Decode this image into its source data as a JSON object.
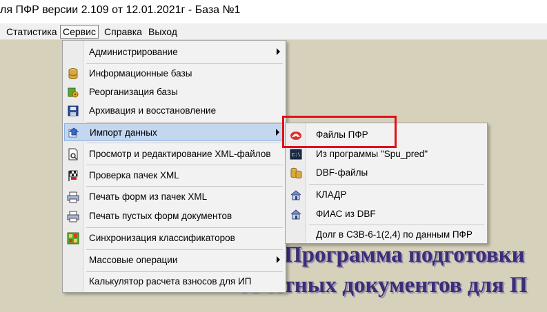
{
  "window": {
    "title": "ля ПФР версии 2.109 от 12.01.2021г - База №1"
  },
  "menubar": {
    "statistics": "Статистика",
    "service": "Сервис",
    "help": "Справка",
    "exit": "Выход"
  },
  "service_menu": {
    "administration": "Администрирование",
    "info_bases": "Информационные базы",
    "reorg_base": "Реорганизация базы",
    "archive_restore": "Архивация и восстановление",
    "import_data": "Импорт данных",
    "xml_edit": "Просмотр и редактирование XML-файлов",
    "xml_check": "Проверка пачек XML",
    "print_xml": "Печать форм из пачек XML",
    "print_blank": "Печать пустых форм документов",
    "sync_classifiers": "Синхронизация классификаторов",
    "mass_operations": "Массовые операции",
    "calculator": "Калькулятор расчета взносов для ИП"
  },
  "import_submenu": {
    "pfr_files": "Файлы ПФР",
    "from_program": "Из программы \"Spu_pred\"",
    "dbf_files": "DBF-файлы",
    "kladr": "КЛАДР",
    "fias_dbf": "ФИАС из DBF",
    "debt_szv": "Долг в СЗВ-6-1(2,4) по данным ПФР"
  },
  "banner": {
    "line1": "Программа подготовки",
    "line2": "отчетных документов для П"
  },
  "colors": {
    "highlight": "#c3d7f1",
    "marker": "#e0101a",
    "banner_text": "#3b2d78"
  }
}
